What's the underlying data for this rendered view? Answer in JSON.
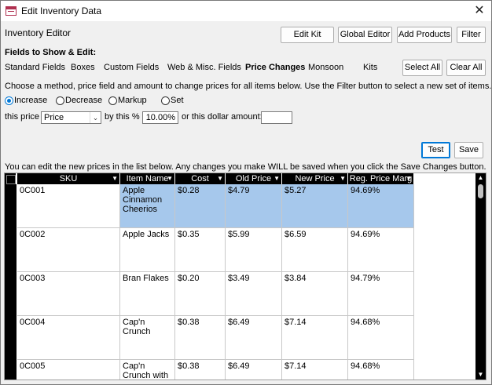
{
  "window": {
    "title": "Edit Inventory Data"
  },
  "header": {
    "editor_title": "Inventory Editor",
    "buttons": {
      "edit_kit": "Edit Kit",
      "global_editor": "Global Editor",
      "add_products": "Add Products",
      "filter": "Filter"
    }
  },
  "fields": {
    "title": "Fields to Show & Edit:",
    "tabs": [
      "Standard Fields",
      "Boxes",
      "Custom Fields",
      "Web & Misc. Fields",
      "Price Changes",
      "Monsoon",
      "Kits"
    ],
    "active_tab": "Price Changes",
    "select_all": "Select All",
    "clear_all": "Clear All"
  },
  "price_changes": {
    "instructions": "Choose a method, price field and amount to change prices for all items below. Use the Filter button  to select a new set of items.",
    "methods": [
      "Increase",
      "Decrease",
      "Markup",
      "Set"
    ],
    "selected_method": "Increase",
    "this_price_label": "this price",
    "price_field_value": "Price",
    "by_percent_label": "by this %",
    "percent_value": "10.00%",
    "dollar_label": "or this dollar amount:",
    "dollar_value": "",
    "test_label": "Test",
    "save_label": "Save"
  },
  "grid": {
    "note": "You can edit the new prices in the list below. Any changes you make WILL be saved when you click the Save Changes button.",
    "columns": [
      "SKU",
      "Item Name",
      "Cost",
      "Old Price",
      "New Price",
      "Reg. Price Marg"
    ],
    "rows": [
      {
        "sku": "0C001",
        "name": "Apple Cinnamon Cheerios",
        "cost": "$0.28",
        "old": "$4.79",
        "new": "$5.27",
        "margin": "94.69%"
      },
      {
        "sku": "0C002",
        "name": "Apple Jacks",
        "cost": "$0.35",
        "old": "$5.99",
        "new": "$6.59",
        "margin": "94.69%"
      },
      {
        "sku": "0C003",
        "name": "Bran Flakes",
        "cost": "$0.20",
        "old": "$3.49",
        "new": "$3.84",
        "margin": "94.79%"
      },
      {
        "sku": "0C004",
        "name": "Cap'n Crunch",
        "cost": "$0.38",
        "old": "$6.49",
        "new": "$7.14",
        "margin": "94.68%"
      },
      {
        "sku": "0C005",
        "name": "Cap'n Crunch with Crunch",
        "cost": "$0.38",
        "old": "$6.49",
        "new": "$7.14",
        "margin": "94.68%"
      }
    ]
  },
  "icons": {
    "close": "close-icon",
    "app": "app-icon",
    "dropdown": "chevron-down-icon",
    "sort": "sort-icon",
    "scroll_up": "scroll-up-icon",
    "scroll_down": "scroll-down-icon"
  },
  "colors": {
    "selection": "#a6c8ec",
    "header_bg": "#000000",
    "accent": "#0078d7"
  }
}
